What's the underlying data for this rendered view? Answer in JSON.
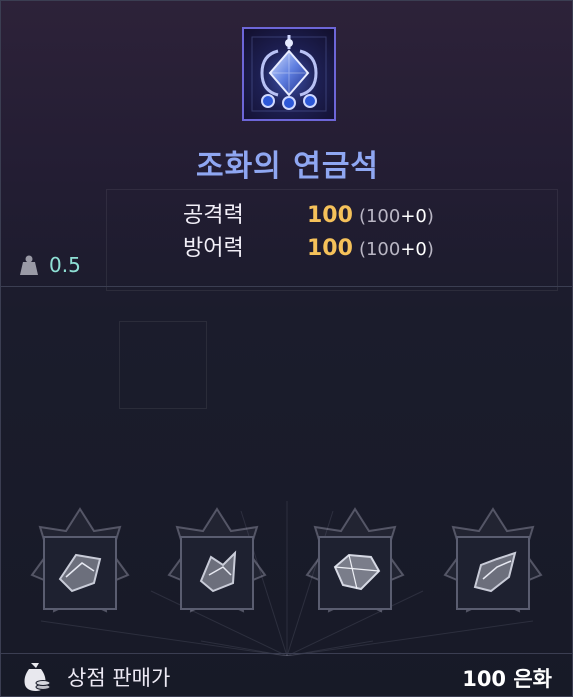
{
  "item": {
    "name": "조화의 연금석",
    "icon": "gem-emblem-icon"
  },
  "stats": [
    {
      "label": "공격력",
      "value": "100",
      "base": "100",
      "bonus": "+0"
    },
    {
      "label": "방어력",
      "value": "100",
      "base": "100",
      "bonus": "+0"
    }
  ],
  "weight": {
    "value": "0.5",
    "icon": "weight-icon"
  },
  "gems": [
    {
      "name": "gem-shard-1",
      "icon": "crystal-shard-icon"
    },
    {
      "name": "gem-shard-2",
      "icon": "crystal-shard-icon"
    },
    {
      "name": "gem-shard-3",
      "icon": "crystal-shard-icon"
    },
    {
      "name": "gem-shard-4",
      "icon": "crystal-shard-icon"
    }
  ],
  "footer": {
    "label": "상점 판매가",
    "value": "100 은화",
    "icon": "coin-bag-icon"
  },
  "colors": {
    "item_name": "#8fa7f2",
    "stat_value": "#f5c15a",
    "weight_value": "#8fe0d5",
    "border": "#3b3e52"
  }
}
